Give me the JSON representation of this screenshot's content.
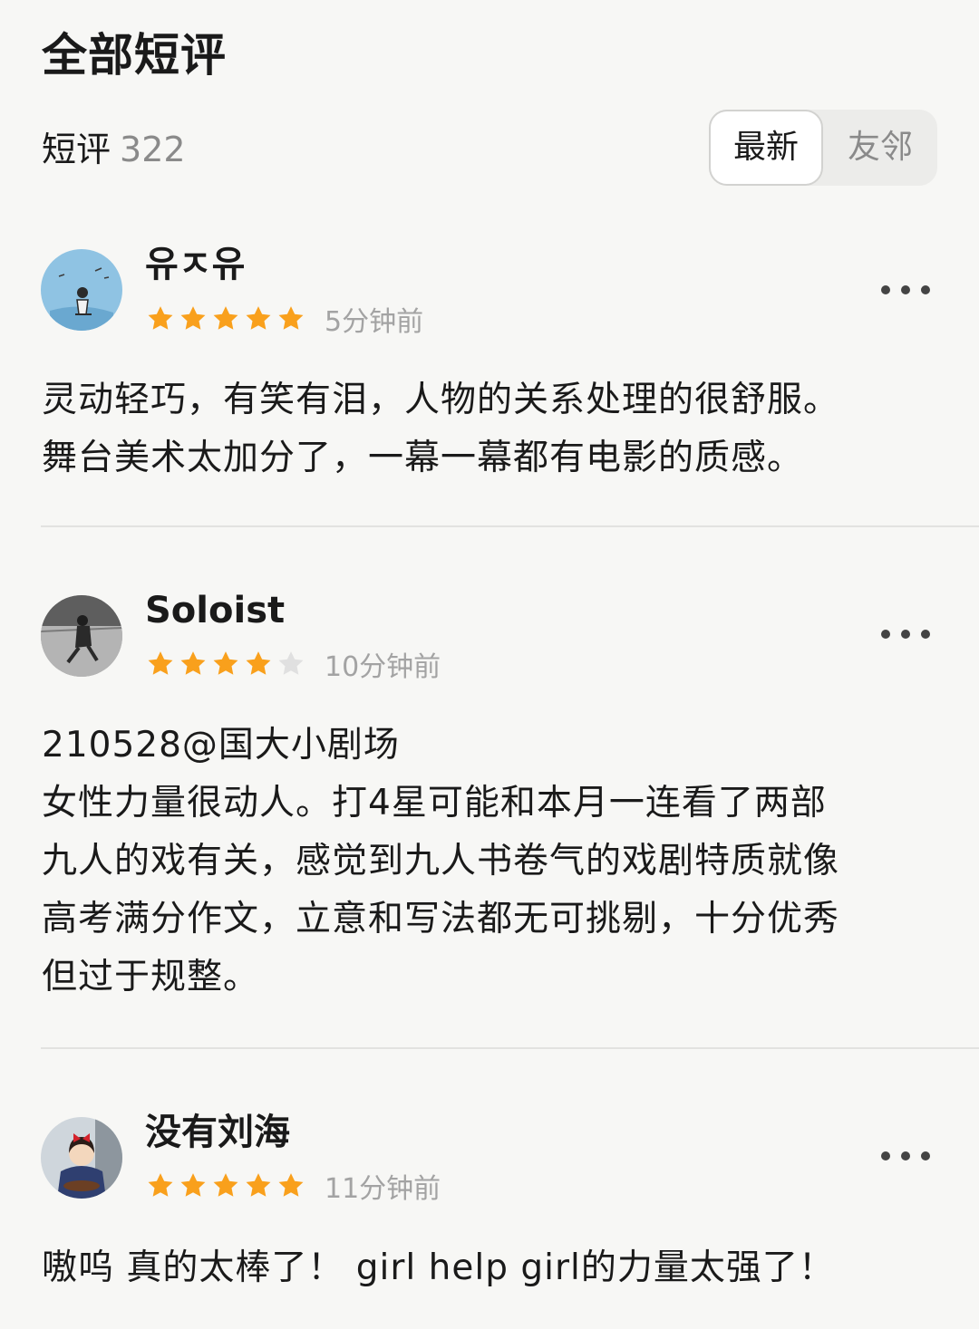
{
  "page": {
    "title": "全部短评",
    "count_label": "短评",
    "count_value": "322"
  },
  "sort_tabs": {
    "active": "最新",
    "inactive": "友邻"
  },
  "reviews": [
    {
      "username": "유ㅈ유",
      "rating": 5,
      "time": "5分钟前",
      "lines": [
        "灵动轻巧，有笑有泪，人物的关系处理的很舒服。",
        "舞台美术太加分了，一幕一幕都有电影的质感。"
      ]
    },
    {
      "username": "Soloist",
      "rating": 4,
      "time": "10分钟前",
      "lines": [
        "210528@国大小剧场",
        "女性力量很动人。打4星可能和本月一连看了两部",
        "九人的戏有关，感觉到九人书卷气的戏剧特质就像",
        "高考满分作文，立意和写法都无可挑剔，十分优秀",
        "但过于规整。"
      ]
    },
    {
      "username": "没有刘海",
      "rating": 5,
      "time": "11分钟前",
      "lines": [
        "嗷呜 真的太棒了！ girl help girl的力量太强了！"
      ]
    }
  ],
  "colors": {
    "star_filled": "#f9a01c",
    "star_empty": "#e0e0e0",
    "background": "#f7f7f5"
  }
}
